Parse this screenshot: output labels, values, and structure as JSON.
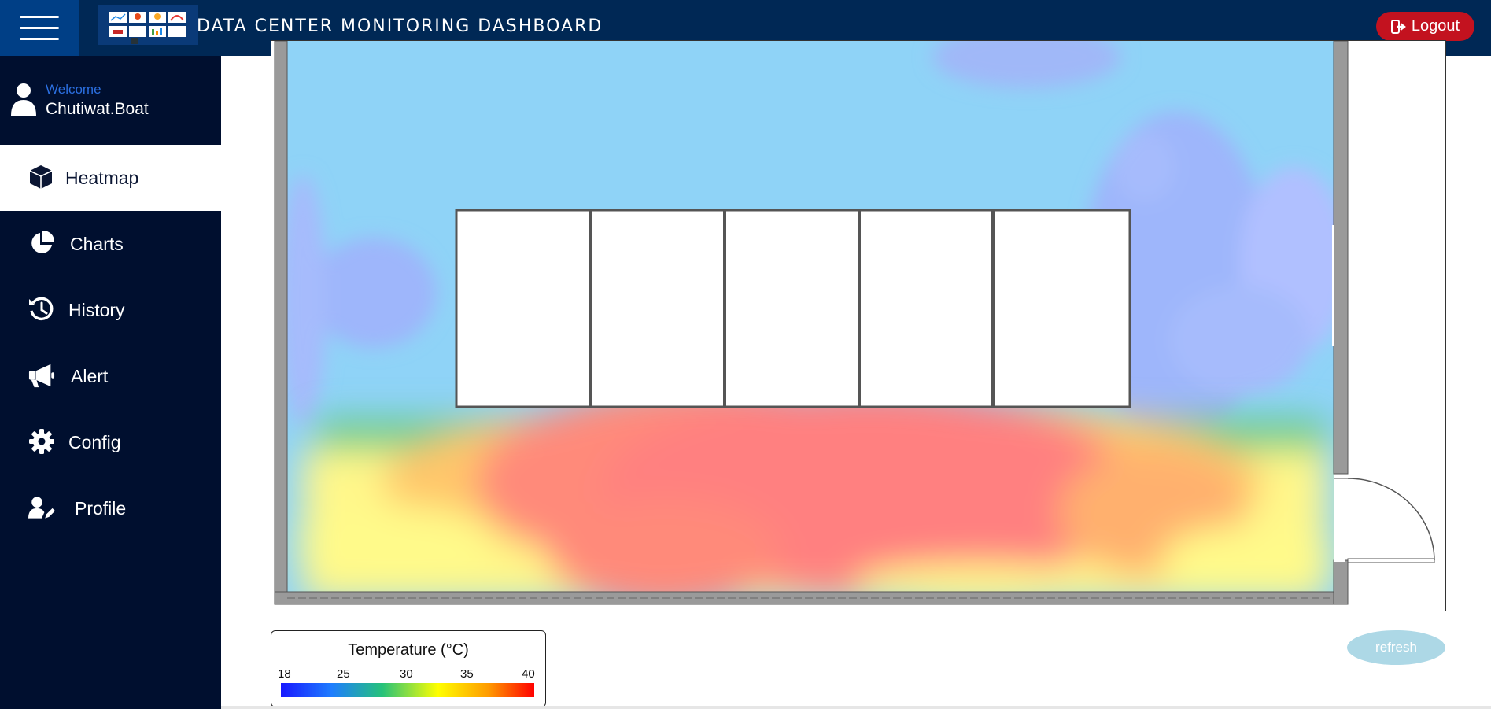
{
  "header": {
    "title": "DATA CENTER MONITORING DASHBOARD",
    "logout_label": "Logout",
    "menu_icon": "hamburger-icon",
    "logout_icon": "sign-out-icon",
    "logo_icon": "dashboard-logo"
  },
  "user": {
    "welcome_label": "Welcome",
    "username": "Chutiwat.Boat",
    "icon": "user-icon"
  },
  "sidebar": {
    "items": [
      {
        "label": "Heatmap",
        "icon": "cube-icon",
        "active": true
      },
      {
        "label": "Charts",
        "icon": "pie-chart-icon",
        "active": false
      },
      {
        "label": "History",
        "icon": "history-icon",
        "active": false
      },
      {
        "label": "Alert",
        "icon": "megaphone-icon",
        "active": false
      },
      {
        "label": "Config",
        "icon": "gear-icon",
        "active": false
      },
      {
        "label": "Profile",
        "icon": "user-edit-icon",
        "active": false
      }
    ]
  },
  "heatmap": {
    "rack_count": 5,
    "legend": {
      "title": "Temperature (°C)",
      "ticks": [
        "18",
        "25",
        "30",
        "35",
        "40"
      ]
    }
  },
  "actions": {
    "refresh_label": "refresh"
  },
  "colors": {
    "topbar": "#002855",
    "sidebar": "#000f2f",
    "logout": "#c3121f",
    "refresh": "#add8e6",
    "cold": "#8fd3f7",
    "hot": "#ff8080",
    "warm": "#fffa8a"
  }
}
